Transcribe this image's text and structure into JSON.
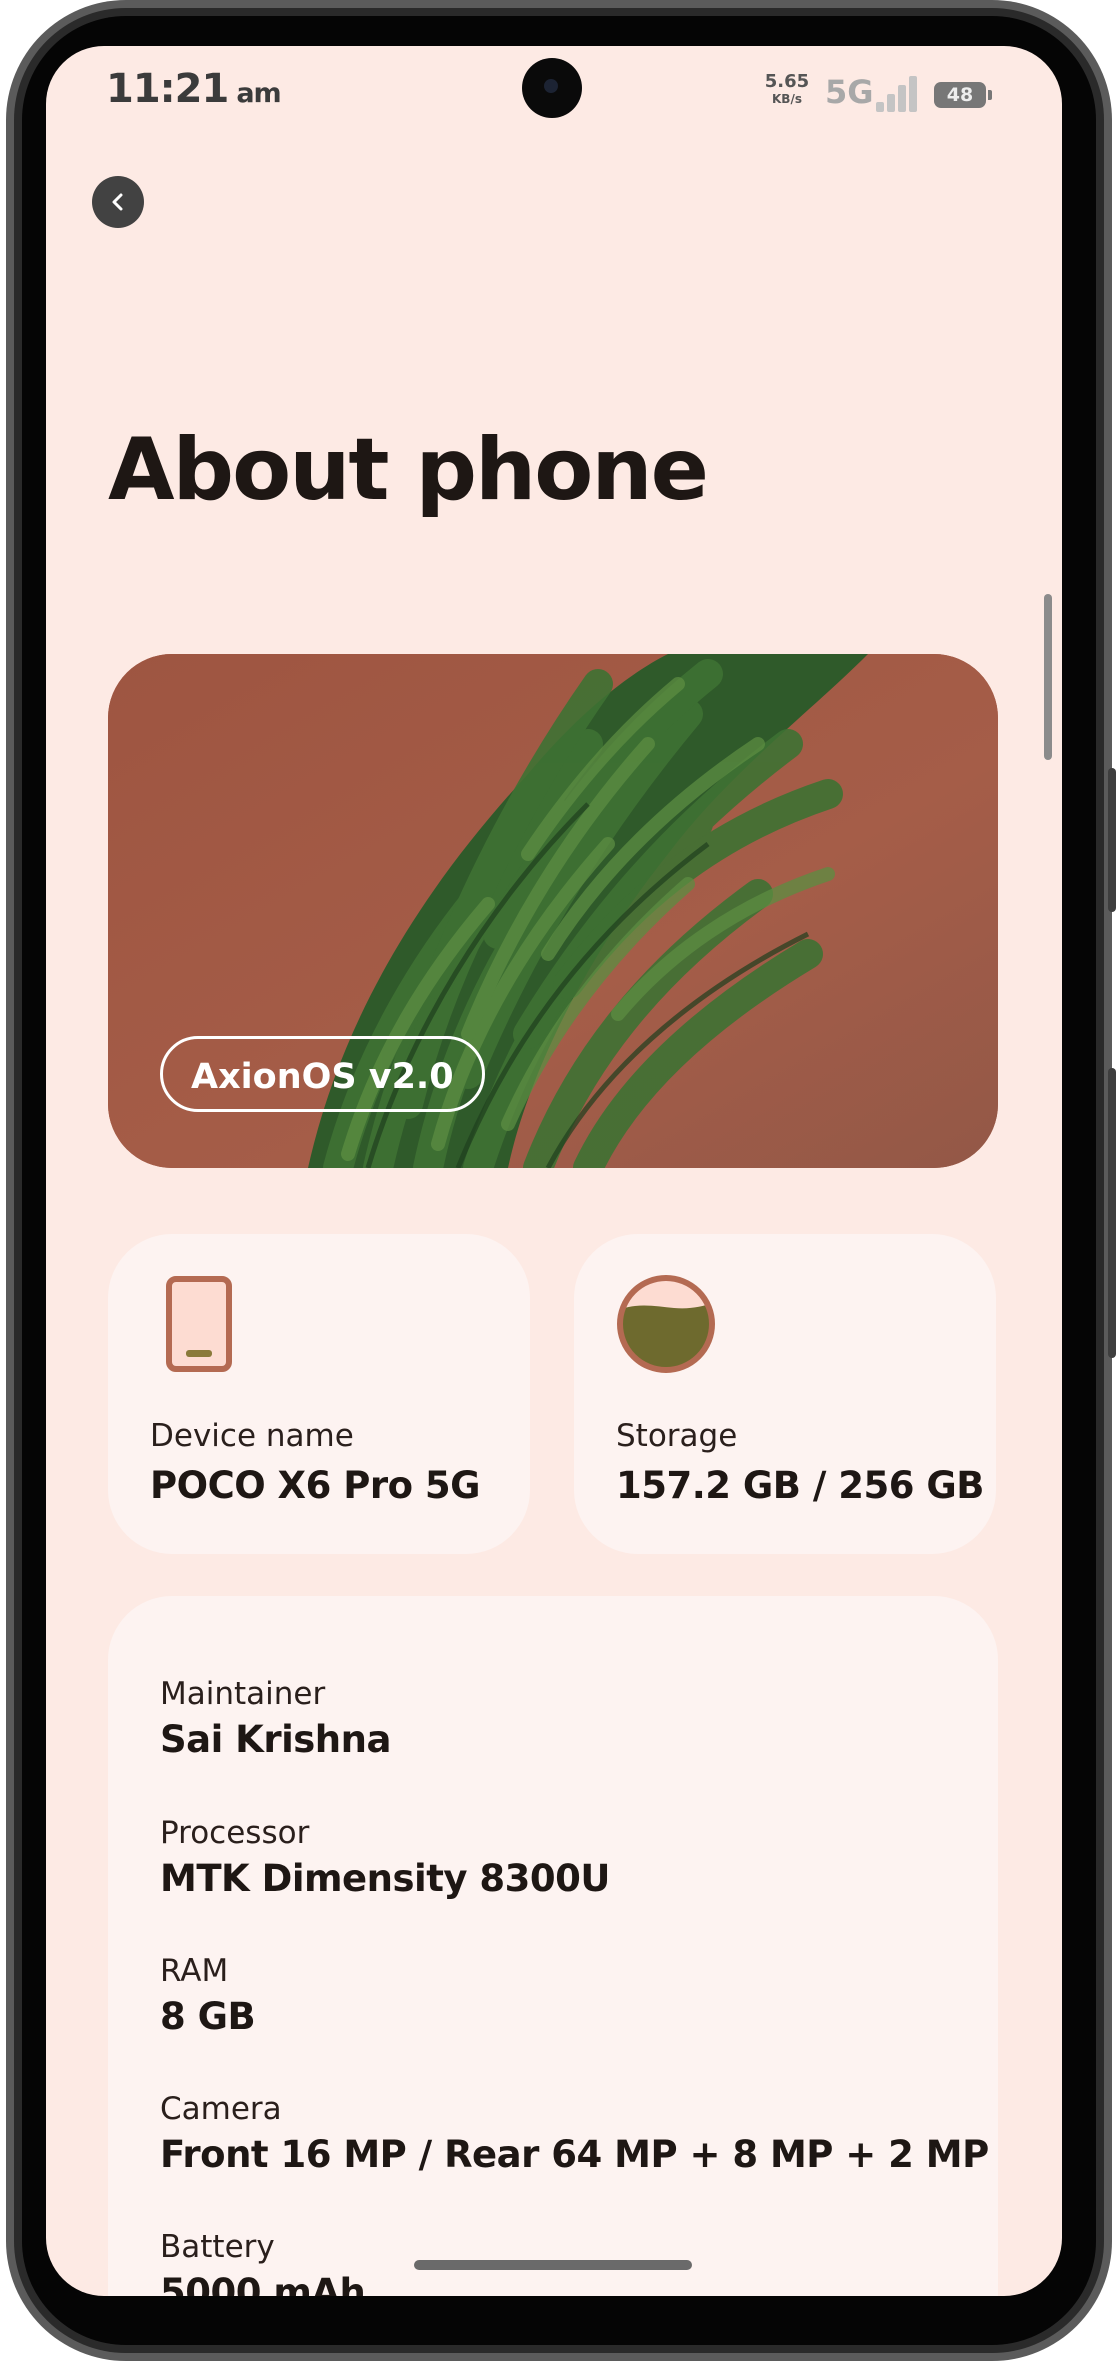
{
  "status_bar": {
    "time": "11:21",
    "ampm": "am",
    "net_speed_value": "5.65",
    "net_speed_unit": "KB/s",
    "network_type": "5G",
    "battery_level": "48"
  },
  "header": {
    "back_icon": "chevron-left-icon",
    "title": "About phone"
  },
  "hero": {
    "os_badge": "AxionOS v2.0"
  },
  "device_card": {
    "icon": "phone-icon",
    "label": "Device name",
    "value": "POCO X6 Pro 5G"
  },
  "storage_card": {
    "icon": "storage-gauge-icon",
    "label": "Storage",
    "value": "157.2 GB / 256 GB"
  },
  "details": [
    {
      "label": "Maintainer",
      "value": "Sai Krishna"
    },
    {
      "label": "Processor",
      "value": "MTK Dimensity 8300U"
    },
    {
      "label": "RAM",
      "value": "8 GB"
    },
    {
      "label": "Camera",
      "value": "Front 16 MP / Rear 64 MP + 8 MP + 2 MP"
    },
    {
      "label": "Battery",
      "value": "5000 mAh"
    }
  ],
  "colors": {
    "background": "#fdeae4",
    "card": "#fdf3f1",
    "hero_wall": "#a45b46",
    "accent": "#b46a52",
    "storage_fill": "#6e6a2e"
  }
}
